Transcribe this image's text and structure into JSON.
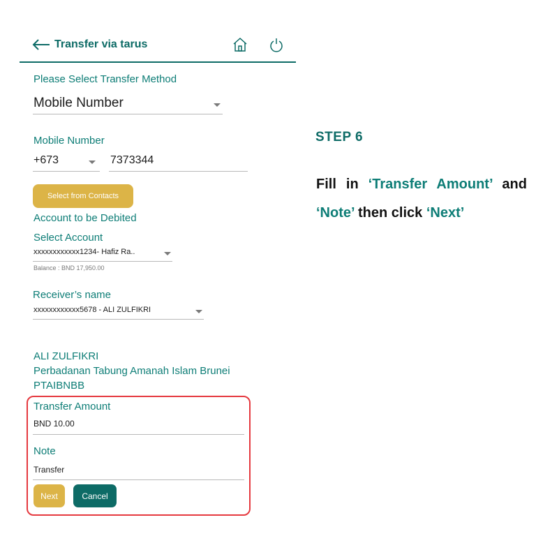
{
  "header": {
    "title": "Transfer via tarus",
    "icons": [
      "back-arrow-icon",
      "home-icon",
      "power-icon"
    ]
  },
  "transfer_method": {
    "label": "Please Select Transfer Method",
    "value": "Mobile Number"
  },
  "mobile": {
    "label": "Mobile Number",
    "country_code": "+673",
    "number": "7373344"
  },
  "contacts_button": "Select from Contacts",
  "debit": {
    "section_label": "Account to be Debited",
    "select_label": "Select Account",
    "account_value": "xxxxxxxxxxxx1234- Hafiz Ra..",
    "balance": "Balance : BND 17,950.00"
  },
  "receiver": {
    "label": "Receiver’s name",
    "value": "xxxxxxxxxxxx5678 - ALI ZULFIKRI"
  },
  "receiver_info": {
    "name": "ALI ZULFIKRI",
    "bank": "Perbadanan Tabung Amanah Islam Brunei",
    "code": "PTAIBNBB"
  },
  "amount": {
    "label": "Transfer Amount",
    "value": "BND 10.00"
  },
  "note": {
    "label": "Note",
    "value": "Transfer"
  },
  "actions": {
    "next": "Next",
    "cancel": "Cancel"
  },
  "step": {
    "title": "STEP 6",
    "t1": "Fill in ",
    "hl1": "‘Transfer Amount’",
    "t2": " and ",
    "hl2": "‘Note’",
    "t3": " then click ",
    "hl3": "‘Next’"
  },
  "colors": {
    "teal": "#0d7d76",
    "gold": "#dcb447",
    "highlight_border": "#e5393f"
  }
}
